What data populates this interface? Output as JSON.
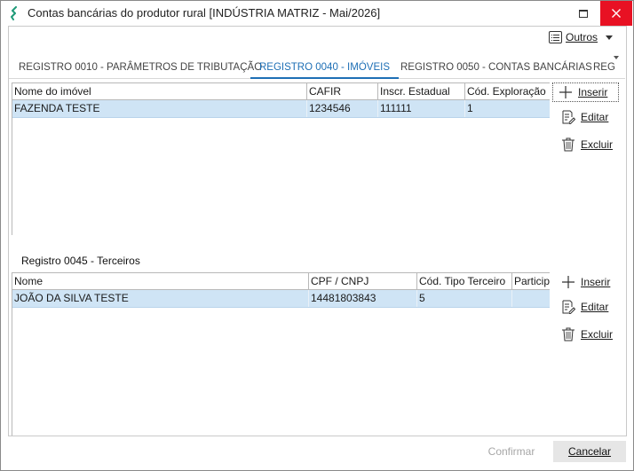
{
  "window": {
    "title": "Contas bancárias do produtor rural [INDÚSTRIA MATRIZ - Mai/2026]"
  },
  "toolbar": {
    "outros_label": "Outros"
  },
  "tabs": [
    {
      "label": "REGISTRO 0010 - PARÂMETROS DE TRIBUTAÇÃO",
      "active": false
    },
    {
      "label": "REGISTRO 0040 - IMÓVEIS",
      "active": true
    },
    {
      "label": "REGISTRO 0050 - CONTAS BANCÁRIAS",
      "active": false
    },
    {
      "label": "REG",
      "active": false
    }
  ],
  "imoveis": {
    "columns": [
      "Nome do imóvel",
      "CAFIR",
      "Inscr. Estadual",
      "Cód. Exploração"
    ],
    "rows": [
      [
        "FAZENDA TESTE",
        "1234546",
        "111111",
        "1"
      ]
    ]
  },
  "imoveis_actions": {
    "inserir": "Inserir",
    "editar": "Editar",
    "excluir": "Excluir"
  },
  "terceiros": {
    "section_label": "Registro 0045 - Terceiros",
    "columns": [
      "Nome",
      "CPF / CNPJ",
      "Cód. Tipo Terceiro",
      "Particip"
    ],
    "rows": [
      [
        "JOÃO DA SILVA TESTE",
        "14481803843",
        "5",
        ""
      ]
    ]
  },
  "terceiros_actions": {
    "inserir": "Inserir",
    "editar": "Editar",
    "excluir": "Excluir"
  },
  "footer": {
    "confirmar": "Confirmar",
    "cancelar": "Cancelar"
  },
  "colors": {
    "accent": "#1e6fb5",
    "selected_row": "#cfe4f5",
    "close": "#e81123",
    "logo": "#1f9a78"
  }
}
